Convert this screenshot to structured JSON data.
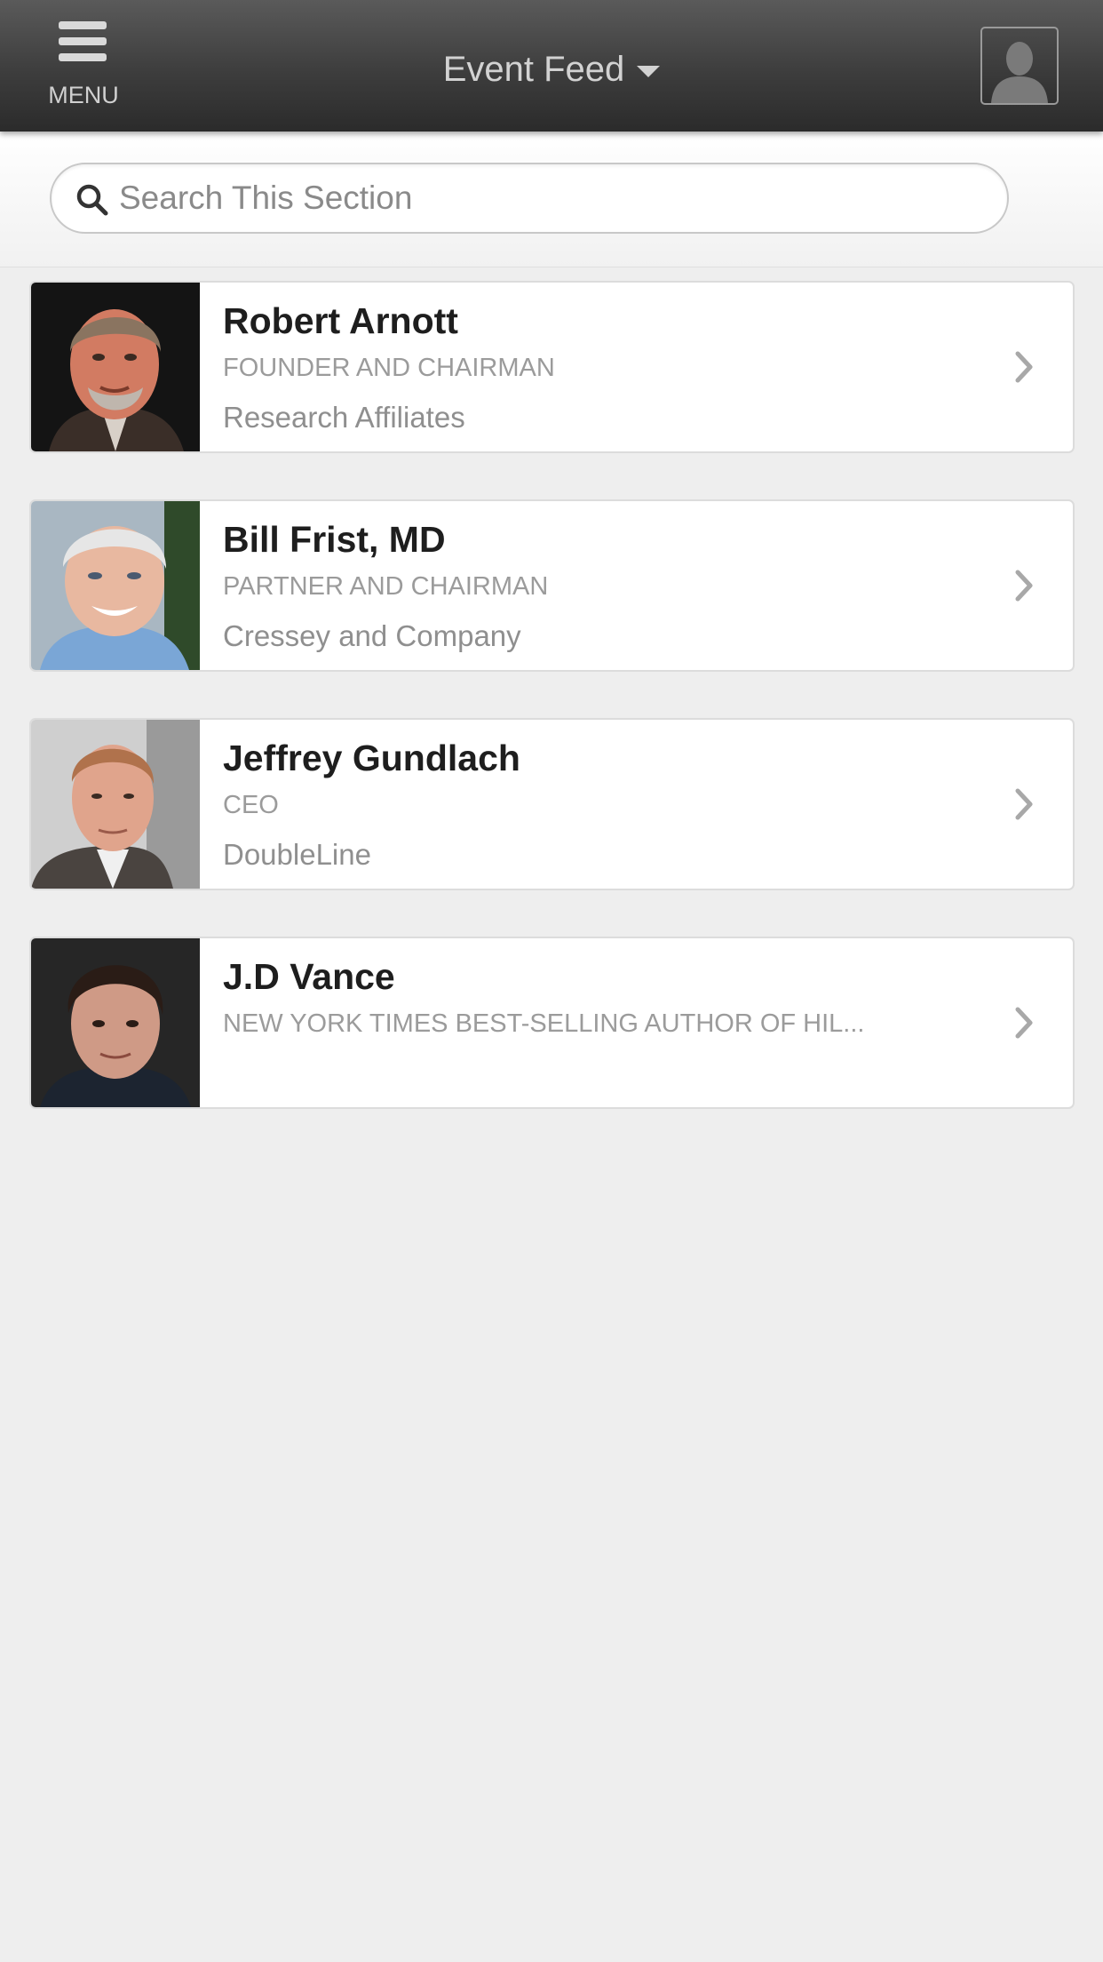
{
  "header": {
    "menu_label": "MENU",
    "title": "Event Feed"
  },
  "search": {
    "placeholder": "Search This Section"
  },
  "speakers": [
    {
      "name": "Robert Arnott",
      "title": "FOUNDER AND CHAIRMAN",
      "company": "Research Affiliates"
    },
    {
      "name": "Bill Frist, MD",
      "title": "PARTNER AND CHAIRMAN",
      "company": "Cressey and Company"
    },
    {
      "name": "Jeffrey Gundlach",
      "title": "CEO",
      "company": "DoubleLine"
    },
    {
      "name": "J.D Vance",
      "title": "NEW YORK TIMES BEST-SELLING AUTHOR OF HIL...",
      "company": ""
    }
  ],
  "colors": {
    "header_bg": "#3d3d3d",
    "page_bg": "#eeeeee",
    "card_bg": "#ffffff",
    "name_text": "#1e1e1e",
    "secondary_text": "#9b9b9b"
  }
}
